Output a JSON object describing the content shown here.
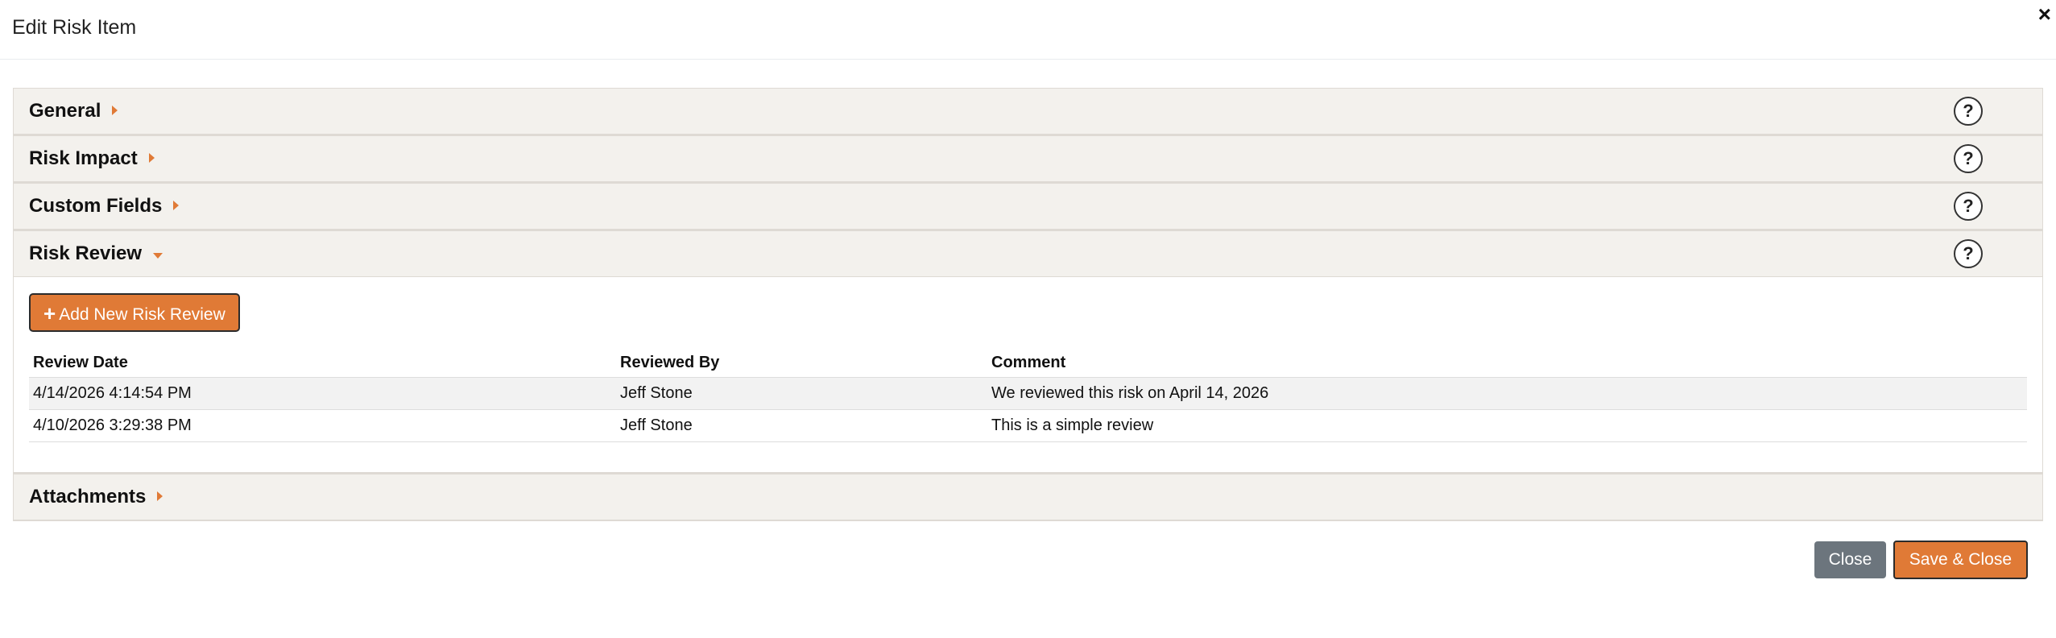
{
  "modal": {
    "title": "Edit Risk Item",
    "close_symbol": "×"
  },
  "panels": {
    "general": {
      "title": "General",
      "expanded": false
    },
    "risk_impact": {
      "title": "Risk Impact",
      "expanded": false
    },
    "custom_fields": {
      "title": "Custom Fields",
      "expanded": false
    },
    "risk_review": {
      "title": "Risk Review",
      "expanded": true
    },
    "attachments": {
      "title": "Attachments",
      "expanded": false
    },
    "help_symbol": "?"
  },
  "risk_review": {
    "add_button_label": "Add New Risk Review",
    "add_button_icon": "+",
    "columns": [
      "Review Date",
      "Reviewed By",
      "Comment"
    ],
    "rows": [
      {
        "date": "4/14/2026 4:14:54 PM",
        "by": "Jeff Stone",
        "comment": "We reviewed this risk on April 14, 2026"
      },
      {
        "date": "4/10/2026 3:29:38 PM",
        "by": "Jeff Stone",
        "comment": "This is a simple review"
      }
    ]
  },
  "footer": {
    "close_label": "Close",
    "save_close_label": "Save & Close"
  },
  "colors": {
    "accent": "#e07a36",
    "secondary": "#6c757d",
    "panel_header_bg": "#f3f1ed"
  }
}
